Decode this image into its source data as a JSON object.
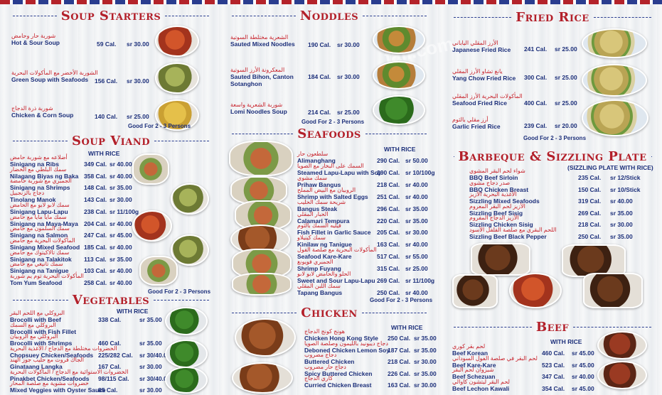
{
  "watermark": "fali.com",
  "sections": {
    "soup_starters": {
      "title": "Soup Starters",
      "items": [
        {
          "ar": "شوربة حار وحامض",
          "en": "Hot & Sour Soup",
          "cal": "59 Cal.",
          "price": "sr 30.00"
        },
        {
          "ar": "الشوربة الأخضر مع المأكولات البحرية",
          "en": "Green Soup with Seafoods",
          "cal": "156 Cal.",
          "price": "sr 30.00"
        },
        {
          "ar": "شوربة ذرة الدجاج",
          "en": "Chicken & Corn Soup",
          "cal": "140 Cal.",
          "price": "sr 25.00"
        }
      ],
      "good_for": "Good For 2 - 3 Persons"
    },
    "noodles": {
      "title": "Noddles",
      "items": [
        {
          "ar": "الشعرية مختلطة السوتية",
          "en": "Sauted Mixed Noodles",
          "cal": "190 Cal.",
          "price": "sr 30.00"
        },
        {
          "ar": "المعكرونة الأرز السوتية",
          "en": "Sauted Bihon, Canton",
          "en2": "Sotanghon",
          "cal": "184 Cal.",
          "price": "sr 30.00"
        },
        {
          "ar": "شوربة الشعرية واسعة",
          "en": "Lomi Noodles Soup",
          "cal": "214 Cal.",
          "price": "sr 25.00"
        }
      ],
      "good_for": "Good For 2 - 3 Persons"
    },
    "fried_rice": {
      "title": "Fried Rice",
      "items": [
        {
          "ar": "الأرز المقلي الياباني",
          "en": "Japanese Fried Rice",
          "cal": "241 Cal.",
          "price": "sr 25.00"
        },
        {
          "ar": "يانغ تشاو الأرز المقلي",
          "en": "Yang Chow Fried Rice",
          "cal": "300 Cal.",
          "price": "sr 25.00"
        },
        {
          "ar": "المأكولات البحرية الأرز المقلي",
          "en": "Seafood Fried Rice",
          "cal": "400 Cal.",
          "price": "sr 25.00"
        },
        {
          "ar": "أرز مقلي بالثوم",
          "en": "Garlic Fried Rice",
          "cal": "239 Cal.",
          "price": "sr 20.00"
        }
      ],
      "good_for": "Good For 2 - 3 Persons"
    },
    "soup_viand": {
      "title": "Soup Viand",
      "col_head": "WITH RICE",
      "items": [
        {
          "ar": "أضلاعه مع شوربة حامض",
          "en": "Sinigang na Ribs",
          "cal": "349 Cal.",
          "price": "sr 40.00"
        },
        {
          "ar": "سمك البلطي مع الخضار",
          "en": "Nilagang Biyas ng Baka",
          "cal": "358 Cal.",
          "price": "sr 40.00"
        },
        {
          "ar": "الجمبري مع شوربة حامضة",
          "en": "Sinigang na Shrimps",
          "cal": "148 Cal.",
          "price": "sr 35.00"
        },
        {
          "ar": "دجاج بالزنجبيل",
          "en": "Tinolang Manok",
          "cal": "143 Cal.",
          "price": "sr 30.00"
        },
        {
          "ar": "سمك لابو لابو مع الحامض",
          "en": "Sinigang Lapu-Lapu",
          "cal": "238 Cal.",
          "price": "sr 11/100g"
        },
        {
          "ar": "سمك مايا مايا مع حامض",
          "en": "Sinigang na Maya-Maya",
          "cal": "204 Cal.",
          "price": "sr 40.00"
        },
        {
          "ar": "سمك السلمون مع حامض",
          "en": "Sinigang na Salmon",
          "cal": "247 Cal.",
          "price": "sr 45.00"
        },
        {
          "ar": "المأكولات البحرية مع حامض",
          "en": "Sinigang Mixed Seafood",
          "cal": "185 Cal.",
          "price": "sr 40.00"
        },
        {
          "ar": "سمك تالاكيتوك مع حامض",
          "en": "Sinigang na Talakitok",
          "cal": "113 Cal.",
          "price": "sr 35.00"
        },
        {
          "ar": "سمك تانيغي مع حامض",
          "en": "Sinigang na Tanigue",
          "cal": "103 Cal.",
          "price": "sr 40.00"
        },
        {
          "ar": "المأكولات البحرية توم يم شوربة",
          "en": "Tom Yum Seafood",
          "cal": "258 Cal.",
          "price": "sr 40.00"
        }
      ],
      "good_for": "Good For 2 - 3 Persons"
    },
    "seafoods": {
      "title": "Seafoods",
      "col_head": "WITH RICE",
      "items": [
        {
          "ar": "سلطعون حار",
          "en": "Alimanghang",
          "cal": "290 Cal.",
          "price": "sr 50.00"
        },
        {
          "ar": "السمك على البخار مع الصويا",
          "en": "Steamed Lapu-Lapu with Soy",
          "cal": "290 Cal.",
          "price": "sr 10/100g"
        },
        {
          "ar": "سمك مشوي",
          "en": "Prihaw Bangus",
          "cal": "218 Cal.",
          "price": "sr 40.00"
        },
        {
          "ar": "الروبيان مع البيض المملح",
          "en": "Shrimp with Salted Eggs",
          "cal": "251 Cal.",
          "price": "sr 40.00"
        },
        {
          "ar": "شريحة سمك الحليب",
          "en": "Bangus Steak",
          "cal": "296 Cal.",
          "price": "sr 35.00"
        },
        {
          "ar": "الحبار المقلي",
          "en": "Calamari Tempura",
          "cal": "220 Cal.",
          "price": "sr 35.00"
        },
        {
          "ar": "فيليه السمك بالثوم",
          "en": "Fish Fillet in Garlic Sauce",
          "cal": "205 Cal.",
          "price": "sr 30.00"
        },
        {
          "ar": "سمك كينيلاو",
          "en": "Kinilaw ng Tanigue",
          "cal": "163 Cal.",
          "price": "sr 40.00"
        },
        {
          "ar": "المأكولات البحرية مع صلصة الفول",
          "en": "Seafood Kare-Kare",
          "cal": "517 Cal.",
          "price": "sr 55.00"
        },
        {
          "ar": "الجمبري فويونغ",
          "en": "Shrimp Fuyang",
          "cal": "315 Cal.",
          "price": "sr 25.00"
        },
        {
          "ar": "الحلو والحامض لابو لابو",
          "en": "Sweet and Sour Lapu-Lapu",
          "cal": "269 Cal.",
          "price": "sr 11/100g"
        },
        {
          "ar": "سمك اللبن المقلي",
          "en": "Tapang Bangus",
          "cal": "250 Cal.",
          "price": "sr 40.00"
        }
      ],
      "good_for": "Good For 2 - 3 Persons"
    },
    "barbeque": {
      "title": "Barbeque & Sizzling Plate",
      "col_head": "(SIZZLING PLATE WITH RICE)",
      "items": [
        {
          "ar": "شواء لحم البقر المشوي",
          "en": "BBQ Beef Sirloin",
          "cal": "235 Cal.",
          "price": "sr 12/Stick"
        },
        {
          "ar": "صدر دجاج مشوي",
          "en": "BBQ Chicken Breast",
          "cal": "150 Cal.",
          "price": "sr 10/Stick"
        },
        {
          "ar": "الأغذية البحرية الأزيز",
          "en": "Sizzling Mixed Seafoods",
          "cal": "319 Cal.",
          "price": "sr 40.00"
        },
        {
          "ar": "الأزيز لحم البقر المعروم",
          "en": "Sizzling Beef Sisig",
          "cal": "269 Cal.",
          "price": "sr 35.00"
        },
        {
          "ar": "الأزيز الدجاج المفروم",
          "en": "Sizzling Chicken Sisig",
          "cal": "218 Cal.",
          "price": "sr 30.00"
        },
        {
          "ar": "اللحم البقري مع صلصة الفلفل الأسود",
          "en": "Sizzling Beef Black Pepper",
          "cal": "250 Cal.",
          "price": "sr 35.00"
        }
      ]
    },
    "vegetables": {
      "title": "Vegetables",
      "col_head": "WITH RICE",
      "items": [
        {
          "ar": "البروكلي مع اللحم البقر",
          "en": "Brocolli with Beef",
          "cal": "338 Cal.",
          "price": "sr 35.00"
        },
        {
          "ar": "البروكلي مع السمك",
          "en": "Brocolli with Fish Fillet",
          "cal": "",
          "price": ""
        },
        {
          "ar": "البروكلي مع الروبيان",
          "en": "Brocolli with Shrimps",
          "cal": "460 Cal.",
          "price": "sr 35.00"
        },
        {
          "ar": "الخضروات مختلطة مع الدجاج / الأغذية البحرية",
          "en": "Chopsuey Chicken/Seafoods",
          "cal": "225/282 Cal.",
          "price": "sr 30/40.00"
        },
        {
          "ar": "الجاك فروت مع حليب جوز الهند",
          "en": "Ginataang Langka",
          "cal": "167 Cal.",
          "price": "sr 30.00"
        },
        {
          "ar": "الخضروات الاستوائية مع الدجاج / المأكولات البحرية",
          "en": "Pinakbet Chicken/Seafoods",
          "cal": "98/115 Cal.",
          "price": "sr 30/40.00"
        },
        {
          "ar": "خضروات مشوية مع صلصة المحار",
          "en": "Mixed Veggies with Oyster Sauce",
          "cal": "85 Cal.",
          "price": "sr 30.00"
        }
      ]
    },
    "chicken": {
      "title": "Chicken",
      "col_head": "WITH RICE",
      "items": [
        {
          "ar": "هونج كونج الدجاج",
          "en": "Chicken Hong Kong Style",
          "cal": "250 Cal.",
          "price": "sr 35.00"
        },
        {
          "ar": "دجاج ديبونيد بالليمون وصلصة الصويا",
          "en": "Deboned Chicken Lemon Soy",
          "cal": "187 Cal.",
          "price": "sr 35.00"
        },
        {
          "ar": "دجاج مضروب",
          "en": "Buttered Chicken",
          "cal": "218 Cal.",
          "price": "sr 30.00"
        },
        {
          "ar": "دجاج حار مضروب",
          "en": "Spicy Buttered Chicken",
          "cal": "226 Cal.",
          "price": "sr 35.00"
        },
        {
          "ar": "كاري الدجاج",
          "en": "Curried Chicken Breast",
          "cal": "163 Cal.",
          "price": "sr 30.00"
        }
      ]
    },
    "beef": {
      "title": "Beef",
      "col_head": "WITH RICE",
      "items": [
        {
          "ar": "لحم بقر كوري",
          "en": "Beef Korean",
          "cal": "460 Cal.",
          "price": "sr 45.00"
        },
        {
          "ar": "لحم البقر في صلصة الفول السوداني",
          "en": "Beef Kare-Kare",
          "cal": "523 Cal.",
          "price": "sr 45.00"
        },
        {
          "ar": "شيزوان لحم البقر",
          "en": "Beef Schezuan",
          "cal": "347 Cal.",
          "price": "sr 40.00"
        },
        {
          "ar": "لحم البقر ليتشون كاوالي",
          "en": "Beef Lechon Kawali",
          "cal": "354 Cal.",
          "price": "sr 45.00"
        }
      ]
    }
  }
}
